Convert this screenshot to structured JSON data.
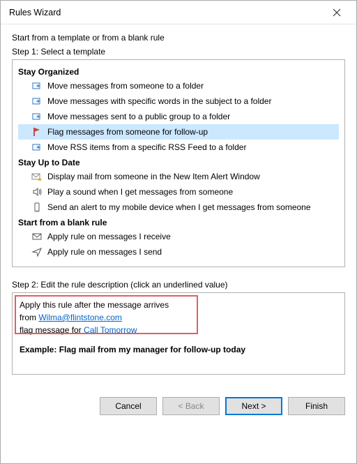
{
  "window": {
    "title": "Rules Wizard"
  },
  "intro": "Start from a template or from a blank rule",
  "step1_label": "Step 1: Select a template",
  "sections": {
    "organized": {
      "head": "Stay Organized",
      "items": [
        "Move messages from someone to a folder",
        "Move messages with specific words in the subject to a folder",
        "Move messages sent to a public group to a folder",
        "Flag messages from someone for follow-up",
        "Move RSS items from a specific RSS Feed to a folder"
      ]
    },
    "uptodate": {
      "head": "Stay Up to Date",
      "items": [
        "Display mail from someone in the New Item Alert Window",
        "Play a sound when I get messages from someone",
        "Send an alert to my mobile device when I get messages from someone"
      ]
    },
    "blank": {
      "head": "Start from a blank rule",
      "items": [
        "Apply rule on messages I receive",
        "Apply rule on messages I send"
      ]
    }
  },
  "step2_label": "Step 2: Edit the rule description (click an underlined value)",
  "description": {
    "line1": "Apply this rule after the message arrives",
    "line2_prefix": "from ",
    "line2_link": "Wilma@flintstone.com",
    "line3_prefix": "flag message for ",
    "line3_link": "Call Tomorrow",
    "example": "Example: Flag mail from my manager for follow-up today"
  },
  "buttons": {
    "cancel": "Cancel",
    "back": "< Back",
    "next": "Next >",
    "finish": "Finish"
  }
}
